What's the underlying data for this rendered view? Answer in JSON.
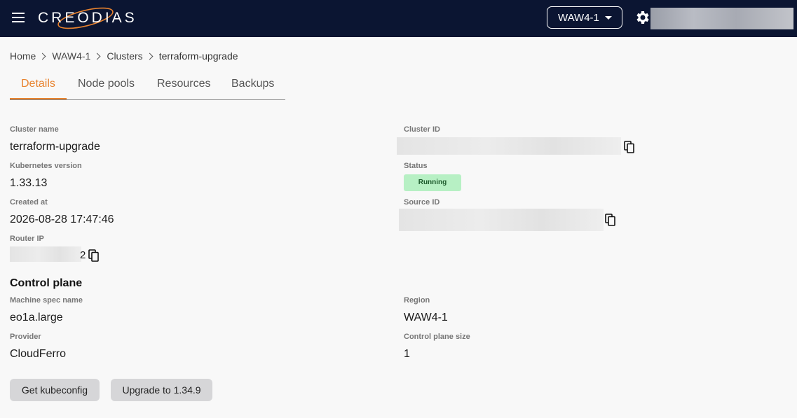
{
  "header": {
    "brand": "CREODIAS",
    "region_selector": "WAW4-1"
  },
  "breadcrumb": [
    "Home",
    "WAW4-1",
    "Clusters",
    "terraform-upgrade"
  ],
  "tabs": [
    "Details",
    "Node pools",
    "Resources",
    "Backups"
  ],
  "details": {
    "cluster_name_label": "Cluster name",
    "cluster_name": "terraform-upgrade",
    "kubernetes_version_label": "Kubernetes version",
    "kubernetes_version": "1.33.13",
    "created_at_label": "Created at",
    "created_at": "2026-08-28 17:47:46",
    "router_ip_label": "Router IP",
    "router_ip_tail": "2",
    "cluster_id_label": "Cluster ID",
    "status_label": "Status",
    "status": "Running",
    "source_id_label": "Source ID"
  },
  "control_plane": {
    "title": "Control plane",
    "machine_spec_label": "Machine spec name",
    "machine_spec": "eo1a.large",
    "provider_label": "Provider",
    "provider": "CloudFerro",
    "region_label": "Region",
    "region": "WAW4-1",
    "size_label": "Control plane size",
    "size": "1"
  },
  "actions": {
    "get_kubeconfig": "Get kubeconfig",
    "upgrade": "Upgrade to 1.34.9"
  },
  "icons": {
    "menu": "menu-icon",
    "settings": "gear-icon",
    "copy": "copy-icon",
    "dropdown": "caret-down-icon"
  },
  "colors": {
    "topbar": "#0b1532",
    "accent": "#e8822e",
    "status_bg": "#b7f0c4",
    "status_text": "#1d5a2c",
    "button_bg": "#d6d6d8"
  }
}
